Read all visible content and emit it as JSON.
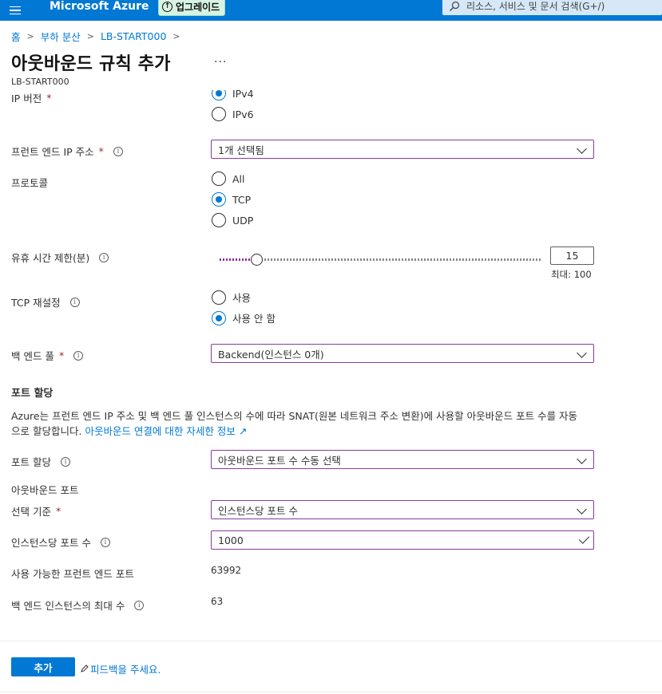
{
  "topbar": {
    "brand": "Microsoft Azure",
    "upgrade_label": "업그레이드",
    "search_placeholder": "리소스, 서비스 및 문서 검색(G+/)"
  },
  "breadcrumb": [
    "홈",
    "부하 분산",
    "LB-START000"
  ],
  "page": {
    "title": "아웃바운드 규칙 추가",
    "more": "...",
    "subtitle": "LB-START000"
  },
  "form": {
    "ip_version": {
      "label": "IP 버전",
      "options": [
        "IPv4",
        "IPv6"
      ],
      "selected": "IPv4"
    },
    "frontend_ip": {
      "label": "프런트 엔드 IP 주소",
      "value": "1개 선택됨"
    },
    "protocol": {
      "label": "프로토콜",
      "options": [
        "All",
        "TCP",
        "UDP"
      ],
      "selected": "TCP"
    },
    "idle_timeout": {
      "label": "유휴 시간 제한(분)",
      "value": "15",
      "max_note": "최대: 100",
      "min": 4,
      "max": 100,
      "current": 15
    },
    "tcp_reset": {
      "label": "TCP 재설정",
      "options": [
        "사용",
        "사용 안 함"
      ],
      "selected": "사용 안 함"
    },
    "backend_pool": {
      "label": "백 엔드 풀",
      "value": "Backend(인스턴스 0개)"
    },
    "port_allocation_section": {
      "title": "포트 할당",
      "desc_text": "Azure는 프런트 엔드 IP 주소 및 백 엔드 풀 인스턴스의 수에 따라 SNAT(원본 네트워크 주소 변환)에 사용할 아웃바운드 포트 수를 자동으로 할당합니다.",
      "desc_link": "아웃바운드 연결에 대한 자세한 정보"
    },
    "port_allocation": {
      "label": "포트 할당",
      "value": "아웃바운드 포트 수 수동 선택"
    },
    "outbound_ports_heading": "아웃바운드 포트",
    "choose_by": {
      "label": "선택 기준",
      "value": "인스턴스당 포트 수"
    },
    "ports_per_instance": {
      "label": "인스턴스당 포트 수",
      "value": "1000"
    },
    "available_ports": {
      "label": "사용 가능한 프런트 엔드 포트",
      "value": "63992"
    },
    "max_backend": {
      "label": "백 엔드 인스턴스의 최대 수",
      "value": "63"
    }
  },
  "footer": {
    "add_label": "추가",
    "feedback_label": "피드백을 주세요."
  }
}
